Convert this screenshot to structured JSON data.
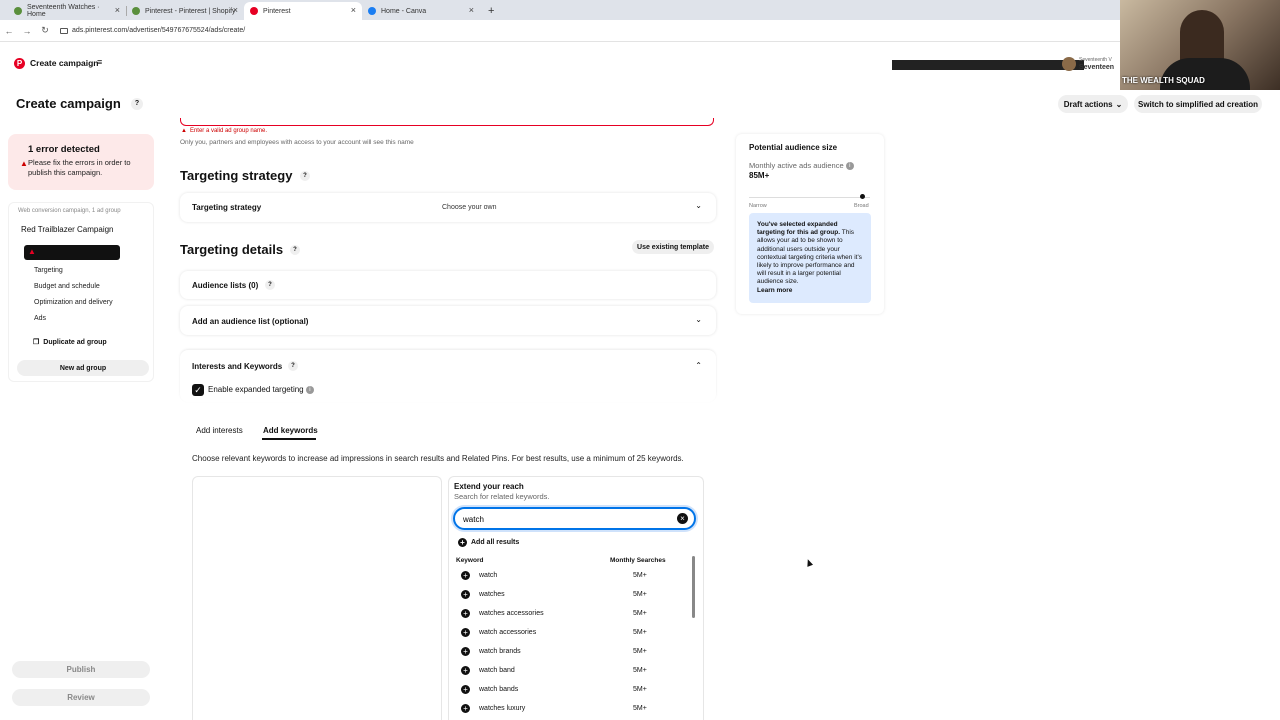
{
  "browser": {
    "tabs": [
      {
        "label": "Seventeenth Watches · Home",
        "favicon_color": "#5a8f3c",
        "active": false
      },
      {
        "label": "Pinterest - Pinterest | Shopify",
        "favicon_color": "#5a8f3c",
        "active": false
      },
      {
        "label": "Pinterest",
        "favicon_color": "#e60023",
        "active": true
      },
      {
        "label": "Home - Canva",
        "favicon_color": "#1b7ef2",
        "active": false
      }
    ],
    "new_tab": "+",
    "url": "ads.pinterest.com/advertiser/549767675524/ads/create/"
  },
  "webcam": {
    "caption": "THE WEALTH SQUAD"
  },
  "account": {
    "name_line1": "Seventeenth V",
    "name_line2": "Seventeen"
  },
  "header": {
    "app_name": "Create campaign",
    "page_title": "Create campaign",
    "help": "?",
    "draft_actions": "Draft actions",
    "simplified": "Switch to simplified ad creation"
  },
  "sidebar": {
    "error_title": "1 error detected",
    "error_desc": "Please fix the errors in order to publish this campaign.",
    "campaign_meta": "Web conversion campaign, 1 ad group",
    "campaign_name": "Red Trailblazer Campaign",
    "items": [
      "Targeting",
      "Budget and schedule",
      "Optimization and delivery",
      "Ads"
    ],
    "duplicate": "Duplicate ad group",
    "new_ad_group": "New ad group",
    "publish": "Publish",
    "review": "Review"
  },
  "main": {
    "ad_group_error": "Enter a valid ad group name.",
    "ad_group_hint": "Only you, partners and employees with access to your account will see this name",
    "targeting_strategy_heading": "Targeting strategy",
    "targeting_strategy_label": "Targeting strategy",
    "targeting_strategy_value": "Choose your own",
    "targeting_details_heading": "Targeting details",
    "use_template": "Use existing template",
    "audience_lists": "Audience lists (0)",
    "add_audience": "Add an audience list (optional)",
    "interests_keywords": "Interests and Keywords",
    "expanded_targeting": "Enable expanded targeting",
    "tab_interests": "Add interests",
    "tab_keywords": "Add keywords",
    "keywords_desc": "Choose relevant keywords to increase ad impressions in search results and Related Pins. For best results, use a minimum of 25 keywords.",
    "extend_title": "Extend your reach",
    "extend_sub": "Search for related keywords.",
    "search_value": "watch",
    "add_all": "Add all results",
    "col_keyword": "Keyword",
    "col_searches": "Monthly Searches",
    "keywords": [
      {
        "kw": "watch",
        "ms": "5M+"
      },
      {
        "kw": "watches",
        "ms": "5M+"
      },
      {
        "kw": "watches accessories",
        "ms": "5M+"
      },
      {
        "kw": "watch accessories",
        "ms": "5M+"
      },
      {
        "kw": "watch brands",
        "ms": "5M+"
      },
      {
        "kw": "watch band",
        "ms": "5M+"
      },
      {
        "kw": "watch bands",
        "ms": "5M+"
      },
      {
        "kw": "watches luxury",
        "ms": "5M+"
      }
    ]
  },
  "audience": {
    "title": "Potential audience size",
    "metric": "Monthly active ads audience",
    "value": "85M+",
    "narrow": "Narrow",
    "broad": "Broad",
    "info_bold": "You've selected expanded targeting for this ad group.",
    "info_text": "This allows your ad to be shown to additional users outside your contextual targeting criteria when it's likely to improve performance and will result in a larger potential audience size.",
    "learn_more": "Learn more"
  }
}
